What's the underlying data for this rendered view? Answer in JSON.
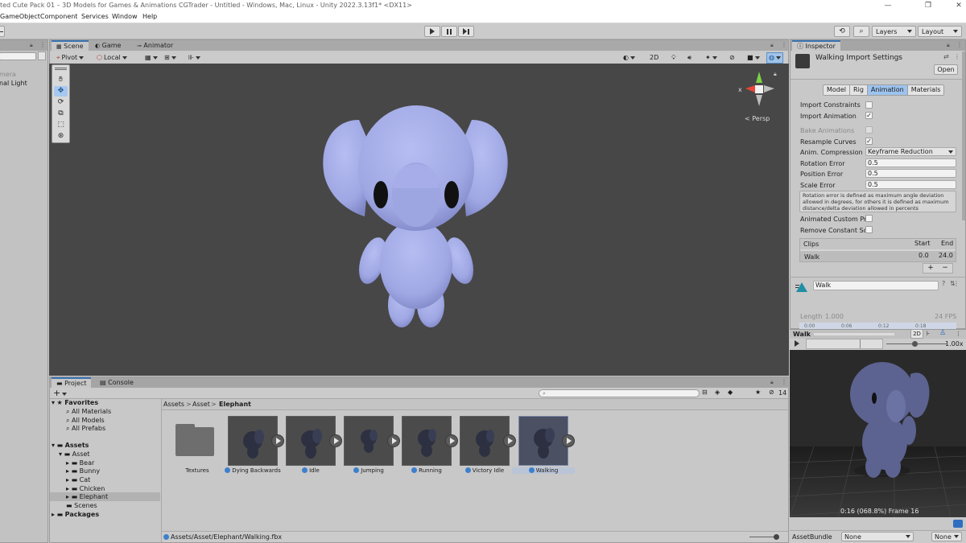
{
  "window": {
    "title": "ted Cute Pack 01 – 3D Models for Games & Animations  CGTrader - Untitled - Windows, Mac, Linux - Unity 2022.3.13f1* <DX11>"
  },
  "menu": [
    "GameObject",
    "Component",
    "Services",
    "Window",
    "Help"
  ],
  "toolbar": {
    "layers_label": "Layers",
    "layout_label": "Layout"
  },
  "hierarchy": {
    "items": [
      "mera",
      "nal Light"
    ]
  },
  "scene_tabs": [
    {
      "label": "Scene",
      "icon": "scene-icon",
      "active": true
    },
    {
      "label": "Game",
      "icon": "game-icon",
      "active": false
    },
    {
      "label": "Animator",
      "icon": "animator-icon",
      "active": false
    }
  ],
  "scene_toolbar": {
    "pivot": "Pivot",
    "local": "Local",
    "mode_2d": "2D",
    "persp": "Persp",
    "gizmo_x": "x"
  },
  "inspector": {
    "tab": "Inspector",
    "title": "Walking Import Settings",
    "open_button": "Open",
    "tabs": [
      "Model",
      "Rig",
      "Animation",
      "Materials"
    ],
    "active_tab": "Animation",
    "rows": {
      "import_constraints": "Import Constraints",
      "import_animation": "Import Animation",
      "bake_animations": "Bake Animations",
      "resample_curves": "Resample Curves",
      "anim_compression": "Anim. Compression",
      "rotation_error": "Rotation Error",
      "position_error": "Position Error",
      "scale_error": "Scale Error",
      "animated_custom": "Animated Custom Prc",
      "remove_constant": "Remove Constant Sc"
    },
    "values": {
      "anim_compression": "Keyframe Reduction",
      "rotation_error": "0.5",
      "position_error": "0.5",
      "scale_error": "0.5"
    },
    "help_text": "Rotation error is defined as maximum angle deviation allowed in degrees, for others it is defined as maximum distance/delta deviation allowed in percents",
    "clips": {
      "header": "Clips",
      "start_label": "Start",
      "end_label": "End",
      "name": "Walk",
      "start": "0.0",
      "end": "24.0",
      "add": "+",
      "remove": "−"
    },
    "clip_name_field": "Walk",
    "length_label": "Length",
    "length_value": "1.000",
    "fps": "24 FPS",
    "timeline_ticks": [
      "0:00",
      "0:06",
      "0:12",
      "0:18"
    ]
  },
  "preview": {
    "clip": "Walk",
    "mode_2d": "2D",
    "speed": "1.00x",
    "status": "0:16 (068.8%) Frame 16"
  },
  "asset_bundle": {
    "label": "AssetBundle",
    "value1": "None",
    "value2": "None"
  },
  "project": {
    "tabs": [
      "Project",
      "Console"
    ],
    "add": "+",
    "count": "14",
    "favorites": {
      "label": "Favorites",
      "items": [
        "All Materials",
        "All Models",
        "All Prefabs"
      ]
    },
    "assets_root": "Assets",
    "asset_folder": "Asset",
    "subfolders": [
      "Bear",
      "Bunny",
      "Cat",
      "Chicken",
      "Elephant"
    ],
    "selected_folder": "Elephant",
    "scenes": "Scenes",
    "packages": "Packages",
    "breadcrumb": [
      "Assets",
      "Asset",
      "Elephant"
    ],
    "assets": [
      {
        "name": "Textures",
        "kind": "folder"
      },
      {
        "name": "Dying Backwards",
        "kind": "anim"
      },
      {
        "name": "Idle",
        "kind": "anim"
      },
      {
        "name": "Jumping",
        "kind": "anim"
      },
      {
        "name": "Running",
        "kind": "anim"
      },
      {
        "name": "Victory Idle",
        "kind": "anim"
      },
      {
        "name": "Walking",
        "kind": "anim",
        "selected": true
      }
    ],
    "status_path": "Assets/Asset/Elephant/Walking.fbx"
  },
  "colors": {
    "elephant": "#a9b0ea",
    "scene_bg": "#474747",
    "accent": "#3a72b0"
  }
}
